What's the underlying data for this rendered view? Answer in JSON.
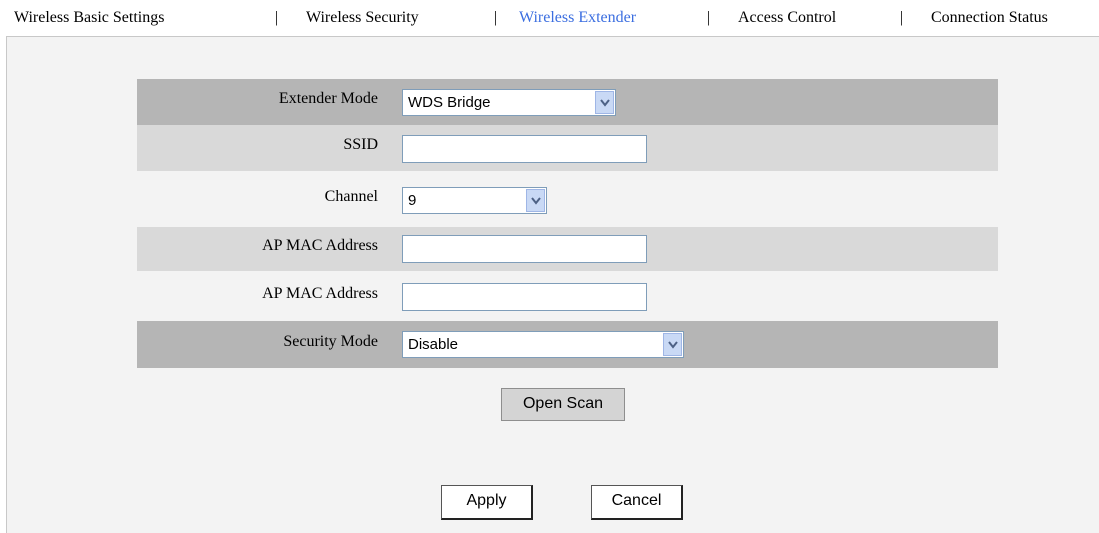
{
  "tabs": [
    {
      "label": "Wireless Basic Settings"
    },
    {
      "label": "Wireless Security"
    },
    {
      "label": "Wireless Extender"
    },
    {
      "label": "Access Control"
    },
    {
      "label": "Connection Status"
    }
  ],
  "tab_separator": "|",
  "active_tab_color": "#3b6ee0",
  "form": {
    "extender_mode": {
      "label": "Extender Mode",
      "value": "WDS Bridge"
    },
    "ssid": {
      "label": "SSID",
      "value": ""
    },
    "channel": {
      "label": "Channel",
      "value": "9"
    },
    "ap_mac_1": {
      "label": "AP MAC Address",
      "value": ""
    },
    "ap_mac_2": {
      "label": "AP MAC Address",
      "value": ""
    },
    "security_mode": {
      "label": "Security Mode",
      "value": "Disable"
    }
  },
  "buttons": {
    "open_scan": "Open Scan",
    "apply": "Apply",
    "cancel": "Cancel"
  }
}
